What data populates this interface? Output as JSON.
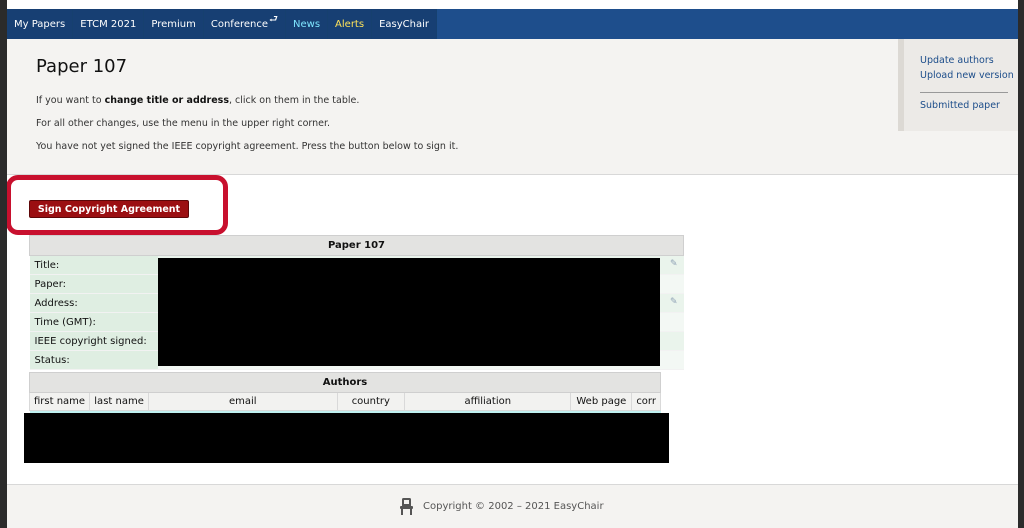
{
  "nav": {
    "items": [
      {
        "label": "My Papers"
      },
      {
        "label": "ETCM 2021"
      },
      {
        "label": "Premium"
      },
      {
        "label": "Conference",
        "return_glyph": "⮐"
      },
      {
        "label": "News"
      },
      {
        "label": "Alerts"
      },
      {
        "label": "EasyChair"
      }
    ]
  },
  "header": {
    "title": "Paper 107",
    "line1_pre": "If you want to ",
    "line1_bold": "change title or address",
    "line1_post": ", click on them in the table.",
    "line2": "For all other changes, use the menu in the upper right corner.",
    "line3": "You have not yet signed the IEEE copyright agreement. Press the button below to sign it."
  },
  "side_menu": {
    "update_authors": "Update authors",
    "upload_new_version": "Upload new version",
    "submitted_paper": "Submitted paper"
  },
  "sign_button": {
    "label": "Sign Copyright Agreement"
  },
  "paper_table": {
    "caption": "Paper 107",
    "rows": [
      {
        "label": "Title:"
      },
      {
        "label": "Paper:"
      },
      {
        "label": "Address:"
      },
      {
        "label": "Time (GMT):"
      },
      {
        "label": "IEEE copyright signed:"
      },
      {
        "label": "Status:"
      }
    ]
  },
  "authors_table": {
    "caption": "Authors",
    "columns": [
      "first name",
      "last name",
      "email",
      "country",
      "affiliation",
      "Web page",
      "corr"
    ]
  },
  "footer": {
    "copyright": "Copyright © 2002 – 2021 EasyChair"
  },
  "colors": {
    "nav_bg": "#1e4e8c",
    "news": "#7fe6ff",
    "alerts": "#ffe35a",
    "sign_button": "#9b0f12",
    "highlight": "#c8102e",
    "link": "#1c4d8a"
  },
  "icons": {
    "edit": "pencil-icon",
    "footer": "easychair-logo-icon"
  }
}
